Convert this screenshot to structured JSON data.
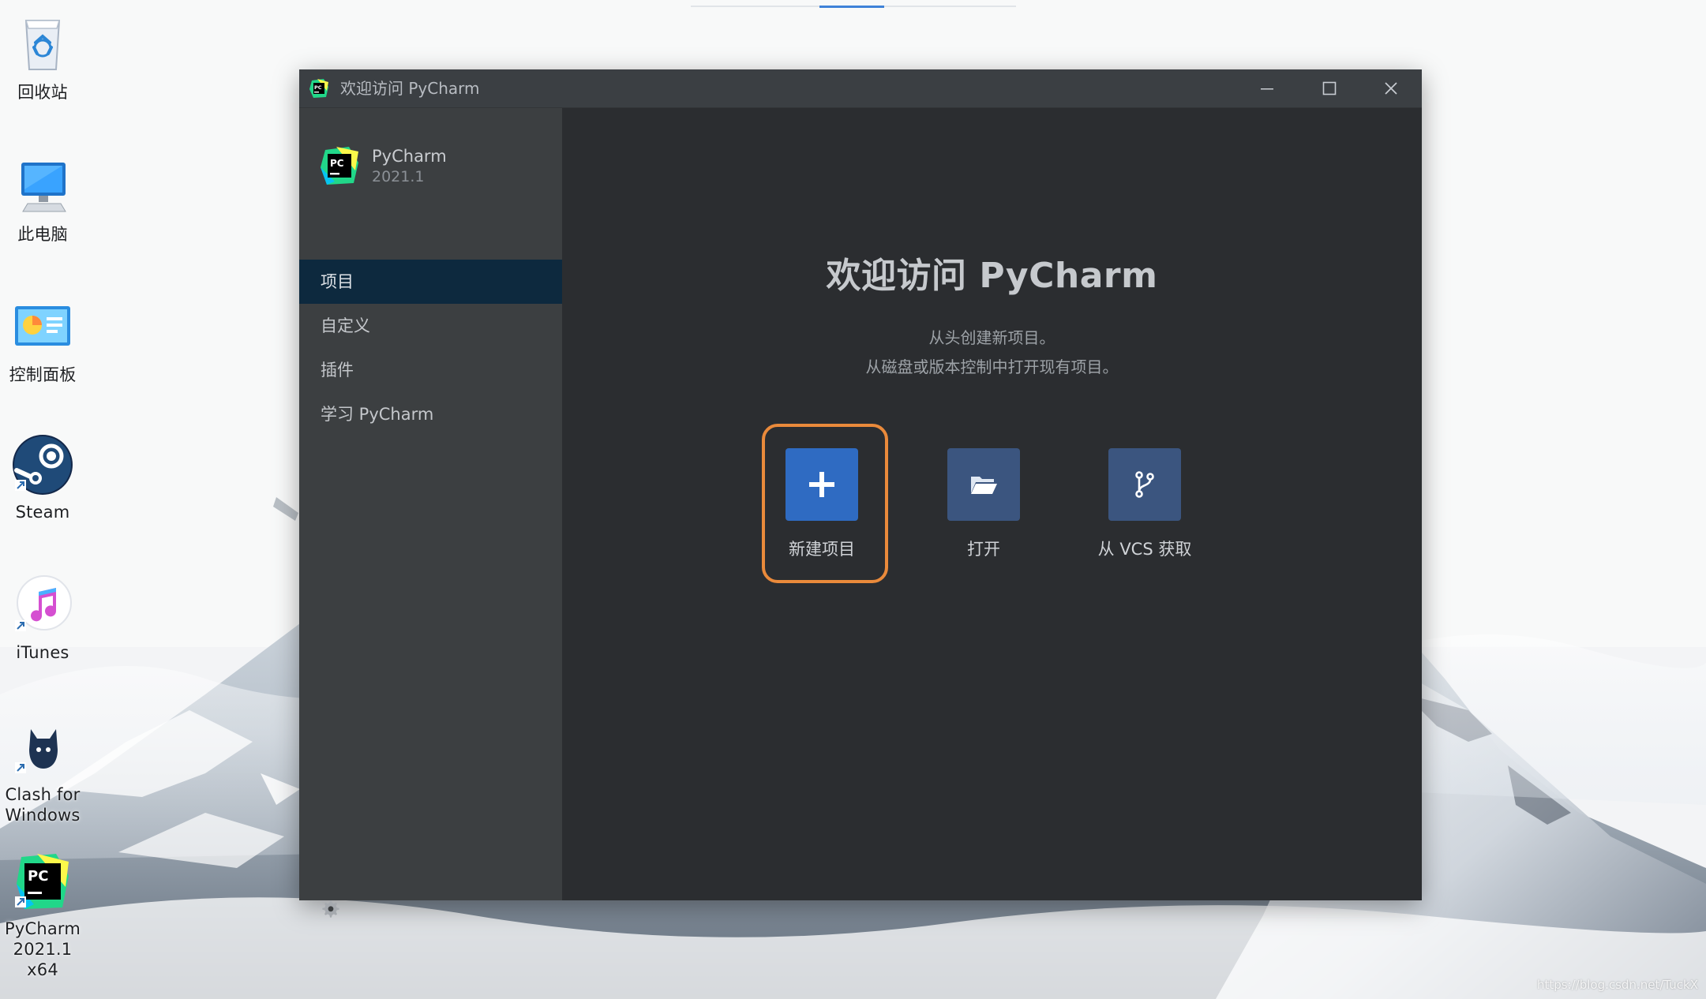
{
  "desktop": {
    "icons": [
      {
        "label": "回收站",
        "icon": "recycle-bin-icon"
      },
      {
        "label": "此电脑",
        "icon": "computer-icon"
      },
      {
        "label": "控制面板",
        "icon": "control-panel-icon"
      },
      {
        "label": "Steam",
        "icon": "steam-icon"
      },
      {
        "label": "iTunes",
        "icon": "itunes-icon"
      },
      {
        "label": "Clash for\nWindows",
        "icon": "clash-icon"
      },
      {
        "label": "PyCharm\n2021.1 x64",
        "icon": "pycharm-icon"
      }
    ]
  },
  "window": {
    "title": "欢迎访问 PyCharm",
    "controls": {
      "minimize_icon": "minimize-icon",
      "maximize_icon": "maximize-icon",
      "close_icon": "close-icon"
    },
    "brand": {
      "name": "PyCharm",
      "version": "2021.1"
    },
    "nav": [
      {
        "label": "项目",
        "active": true
      },
      {
        "label": "自定义",
        "active": false
      },
      {
        "label": "插件",
        "active": false
      },
      {
        "label": "学习 PyCharm",
        "active": false
      }
    ],
    "settings_icon": "gear-icon",
    "main": {
      "heading": "欢迎访问 PyCharm",
      "subtitle_line1": "从头创建新项目。",
      "subtitle_line2": "从磁盘或版本控制中打开现有项目。",
      "actions": [
        {
          "label": "新建项目",
          "icon": "plus-icon",
          "highlighted": true,
          "color": "#2f6bc2"
        },
        {
          "label": "打开",
          "icon": "folder-open-icon",
          "highlighted": false,
          "color": "#3b557f"
        },
        {
          "label": "从 VCS 获取",
          "icon": "vcs-branch-icon",
          "highlighted": false,
          "color": "#3b557f"
        }
      ]
    }
  },
  "colors": {
    "window_bg": "#2b2d30",
    "sidebar_bg": "#3c3f41",
    "active_nav_bg": "#0d293e",
    "primary_button": "#2f6bc2",
    "secondary_button": "#3b557f",
    "highlight_border": "#ea8a3b"
  },
  "watermark": "https://blog.csdn.net/TuckX"
}
